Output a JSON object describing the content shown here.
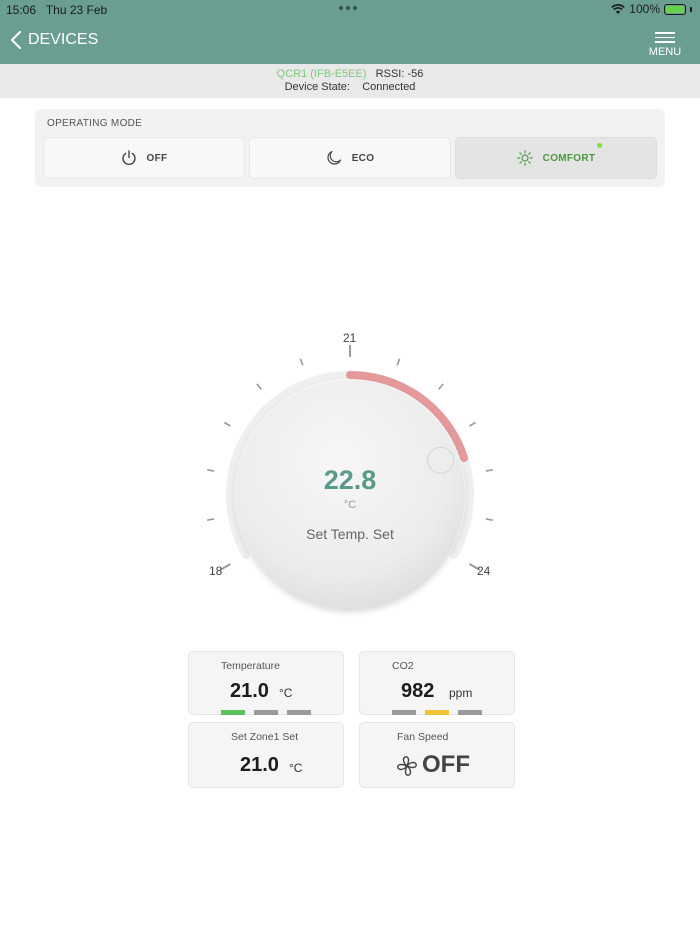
{
  "status_bar": {
    "time": "15:06",
    "date": "Thu 23 Feb",
    "battery": "100%",
    "battery_level": 1.0
  },
  "nav": {
    "back_label": "DEVICES",
    "menu_label": "MENU"
  },
  "device": {
    "name": "QCR1 (IFB-E5EE)",
    "rssi": "RSSI: -56",
    "state_label": "Device State:",
    "state_value": "Connected"
  },
  "operating_mode": {
    "title": "OPERATING MODE",
    "modes": [
      {
        "label": "OFF",
        "icon": "power-icon"
      },
      {
        "label": "ECO",
        "icon": "moon-icon"
      },
      {
        "label": "COMFORT",
        "icon": "sun-icon"
      }
    ],
    "selected": "COMFORT"
  },
  "dial": {
    "value": "22.8",
    "unit": "°C",
    "label": "Set Temp. Set",
    "min_label": "18",
    "mid_label": "21",
    "max_label": "24",
    "range": [
      18,
      24
    ],
    "setpoint": 22.8,
    "arc_color": "#e07e7e"
  },
  "cards": {
    "temperature": {
      "title": "Temperature",
      "value": "21.0",
      "unit": "°C",
      "level_colors": [
        "#5cc15a",
        "#9a9a9a",
        "#9a9a9a"
      ]
    },
    "co2": {
      "title": "CO2",
      "value": "982",
      "unit": "ppm",
      "level_colors": [
        "#9a9a9a",
        "#f0c43a",
        "#9a9a9a"
      ]
    },
    "setpoint": {
      "title": "Set Zone1 Set",
      "value": "21.0",
      "unit": "°C"
    },
    "fan": {
      "title": "Fan Speed",
      "value": "OFF",
      "icon": "fan-icon"
    }
  },
  "colors": {
    "header": "#6a9e91",
    "accent_green": "#4a9a3c",
    "dial_value": "#5a9a8a"
  }
}
